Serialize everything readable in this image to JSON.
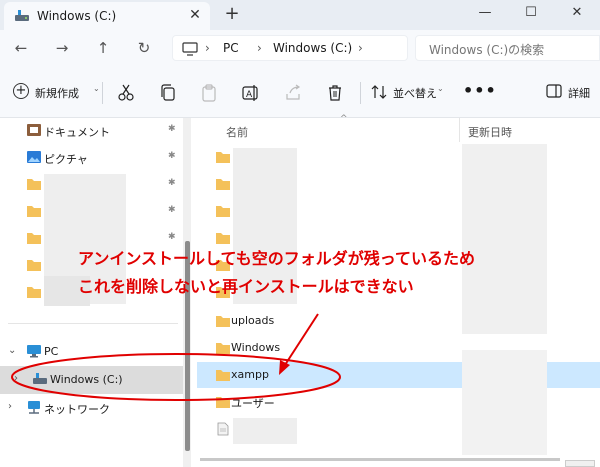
{
  "window": {
    "tab_title": "Windows (C:)",
    "tab_close": "✕",
    "new_tab": "+",
    "minimize": "—",
    "maximize": "☐",
    "close": "✕"
  },
  "nav": {
    "back": "←",
    "forward": "→",
    "up": "↑",
    "refresh": "↻",
    "breadcrumb": [
      "PC",
      "Windows (C:)"
    ],
    "breadcrumb_sep": "›",
    "search_placeholder": "Windows (C:)の検索"
  },
  "toolbar": {
    "new_label": "新規作成",
    "sort_label": "並べ替え",
    "more": "•••",
    "details_label": "詳細",
    "chevron": "⌄"
  },
  "sidebar": {
    "items": [
      {
        "label": "ドキュメント",
        "icon": "documents-icon",
        "pinned": true
      },
      {
        "label": "ピクチャ",
        "icon": "pictures-icon",
        "pinned": true
      }
    ],
    "pin_glyph": "📌",
    "pc_label": "PC",
    "drive_label": "Windows (C:)",
    "network_label": "ネットワーク"
  },
  "main": {
    "columns": {
      "name": "名前",
      "modified": "更新日時"
    },
    "sort_indicator": "^",
    "files": [
      "",
      "",
      "",
      "",
      "",
      "",
      "uploads",
      "Windows",
      "xampp",
      "ユーザー",
      ""
    ]
  },
  "annotation": {
    "line1": "アンインストールしても空のフォルダが残っているため",
    "line2": "これを削除しないと再インストールはできない",
    "color": "#e00000"
  },
  "colors": {
    "folder": "#f4c15a",
    "selection": "#cce8ff",
    "accent": "#0067c0"
  }
}
